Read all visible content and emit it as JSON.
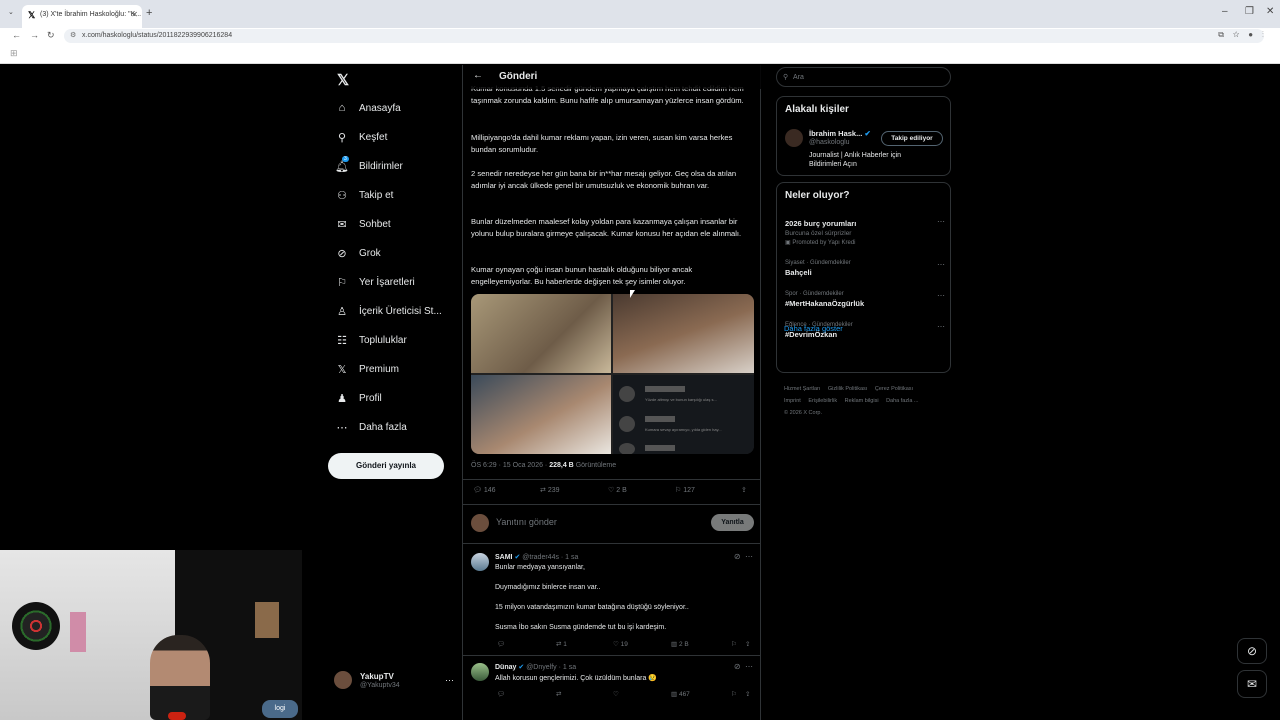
{
  "browser": {
    "tab_title": "(3) X'te İbrahim Haskoloğlu: \"K...",
    "url": "x.com/haskologlu/status/2011822939906216284"
  },
  "nav": {
    "items": [
      {
        "label": "Anasayfa",
        "icon": "home-icon"
      },
      {
        "label": "Keşfet",
        "icon": "search-icon"
      },
      {
        "label": "Bildirimler",
        "icon": "bell-icon"
      },
      {
        "label": "Takip et",
        "icon": "person-add-icon"
      },
      {
        "label": "Sohbet",
        "icon": "mail-icon"
      },
      {
        "label": "Grok",
        "icon": "grok-icon"
      },
      {
        "label": "Yer İşaretleri",
        "icon": "bookmark-icon"
      },
      {
        "label": "İçerik Üreticisi St...",
        "icon": "creator-icon"
      },
      {
        "label": "Topluluklar",
        "icon": "communities-icon"
      },
      {
        "label": "Premium",
        "icon": "x-icon"
      },
      {
        "label": "Profil",
        "icon": "profile-icon"
      },
      {
        "label": "Daha fazla",
        "icon": "more-icon"
      }
    ],
    "notification_badge": "3",
    "post_button": "Gönderi yayınla",
    "account": {
      "name": "YakupTV",
      "handle": "@Yakuptv34"
    }
  },
  "main": {
    "header_title": "Gönderi",
    "paragraphs": [
      "Kumar konusunda 1.5 senedir gündem yapmaya çalıştım hem tehdit edildim hem taşınmak zorunda kaldım. Bunu hafife alıp umursamayan yüzlerce insan gördüm.",
      "Millipiyango'da dahil kumar reklamı yapan, izin veren, susan kim varsa herkes bundan sorumludur.",
      "2 senedir neredeyse her gün bana bir in**har mesajı geliyor. Geç olsa da atılan adımlar iyi ancak ülkede genel bir umutsuzluk ve ekonomik buhran var.",
      "Bunlar düzelmeden maalesef kolay yoldan para kazanmaya çalışan insanlar bir yolunu bulup buralara girmeye çalışacak. Kumar konusu her açıdan ele alınmalı.",
      "Kumar oynayan çoğu insan bunun hastalık olduğunu biliyor ancak engelleyemiyorlar. Bu haberlerde değişen tek şey isimler oluyor."
    ],
    "media_blurred_lines": [
      "Yüzde altmışı ve bunun karşılığı ulaş s...",
      "Kumara sevap ayıramıyo, yılda giden hay..."
    ],
    "meta_time": "ÖS 6:29 · 15 Oca 2026 · ",
    "meta_views": "228,4 B",
    "meta_views_label": " Görüntüleme",
    "stats": {
      "replies": "146",
      "reposts": "239",
      "likes": "2 B",
      "bookmarks": "127"
    },
    "reply_placeholder": "Yanıtını gönder",
    "reply_button": "Yanıtla",
    "replies": [
      {
        "name": "SAMI",
        "handle": "@trader44s · 1 sa",
        "lines": [
          "Bunlar medyaya yansıyanlar,",
          "Duymadığımız binlerce insan var..",
          "15 milyon vatandaşımızın kumar batağına düştüğü söyleniyor..",
          "Susma İbo sakın Susma gündemde tut bu işi kardeşim."
        ],
        "stats": {
          "replies": "",
          "reposts": "1",
          "likes": "19",
          "views": "2 B"
        }
      },
      {
        "name": "Dünay",
        "handle": "@Dnyelfy · 1 sa",
        "lines": [
          "Allah korusun gençlerimizi. Çok üzüldüm bunlara 😢"
        ],
        "stats": {
          "replies": "",
          "reposts": "",
          "likes": "",
          "views": "467"
        }
      }
    ]
  },
  "right": {
    "search_placeholder": "Ara",
    "related_title": "Alakalı kişiler",
    "person": {
      "name": "İbrahim Hask...",
      "handle": "@haskologlu",
      "bio": "Journalist | Anlık Haberler için Bildirimleri Açın",
      "follow_label": "Takip ediliyor"
    },
    "trends_title": "Neler oluyor?",
    "trends": [
      {
        "context": "",
        "title": "2026 burç yorumları",
        "sub": "Burcuna özel sürprizler",
        "promo": "Promoted by Yapı Kredi"
      },
      {
        "context": "Siyaset · Gündemdekiler",
        "title": "Bahçeli",
        "sub": "",
        "promo": ""
      },
      {
        "context": "Spor · Gündemdekiler",
        "title": "#MertHakanaÖzgürlük",
        "sub": "",
        "promo": ""
      },
      {
        "context": "Eğlence · Gündemdekiler",
        "title": "#DevrimÖzkan",
        "sub": "",
        "promo": ""
      }
    ],
    "show_more": "Daha fazla göster",
    "footer": [
      "Hizmet Şartları",
      "Gizlilik Politikası",
      "Çerez Politikası",
      "Imprint",
      "Erişilebilirlik",
      "Reklam bilgisi",
      "Daha fazla ...",
      "© 2026 X Corp."
    ]
  },
  "webcam": {
    "overlay_text": "logi"
  }
}
